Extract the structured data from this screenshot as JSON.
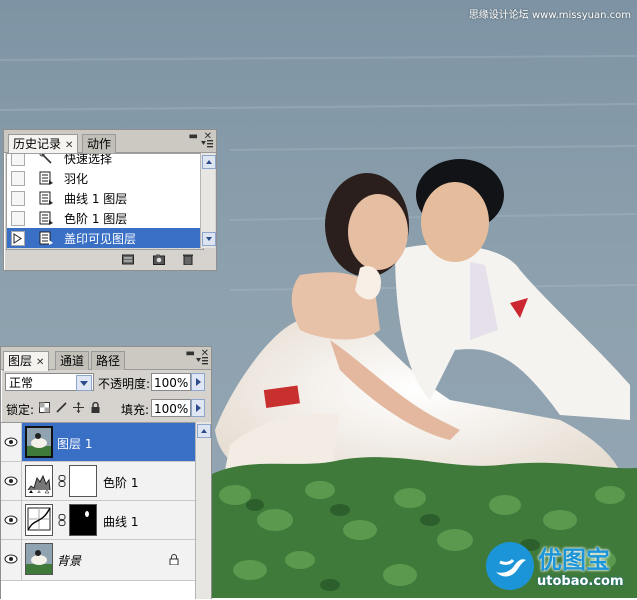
{
  "watermark": "思缘设计论坛 www.missyuan.com",
  "logo": {
    "brand": "优图宝",
    "url": "utobao.com"
  },
  "history_panel": {
    "tabs": [
      {
        "label": "历史记录",
        "active": true
      },
      {
        "label": "动作",
        "active": false
      }
    ],
    "items": [
      {
        "label": "快速选择",
        "selected": false,
        "icon": "quick-select-icon"
      },
      {
        "label": "羽化",
        "selected": false,
        "icon": "history-state-icon"
      },
      {
        "label": "曲线 1 图层",
        "selected": false,
        "icon": "history-state-icon"
      },
      {
        "label": "色阶 1 图层",
        "selected": false,
        "icon": "history-state-icon"
      },
      {
        "label": "盖印可见图层",
        "selected": true,
        "icon": "history-state-icon"
      }
    ]
  },
  "layers_panel": {
    "tabs": [
      {
        "label": "图层",
        "active": true
      },
      {
        "label": "通道",
        "active": false
      },
      {
        "label": "路径",
        "active": false
      }
    ],
    "blend_mode": "正常",
    "opacity_label": "不透明度:",
    "opacity_value": "100%",
    "lock_label": "锁定:",
    "fill_label": "填充:",
    "fill_value": "100%",
    "layers": [
      {
        "name": "图层 1",
        "selected": true,
        "kind": "pixel"
      },
      {
        "name": "色阶 1",
        "selected": false,
        "kind": "levels-adjustment"
      },
      {
        "name": "曲线 1",
        "selected": false,
        "kind": "curves-adjustment"
      },
      {
        "name": "背景",
        "selected": false,
        "kind": "background",
        "locked": true
      }
    ]
  },
  "colors": {
    "selection": "#3a6fc6",
    "panel": "#d6d3ce",
    "brand": "#1c95d8"
  }
}
